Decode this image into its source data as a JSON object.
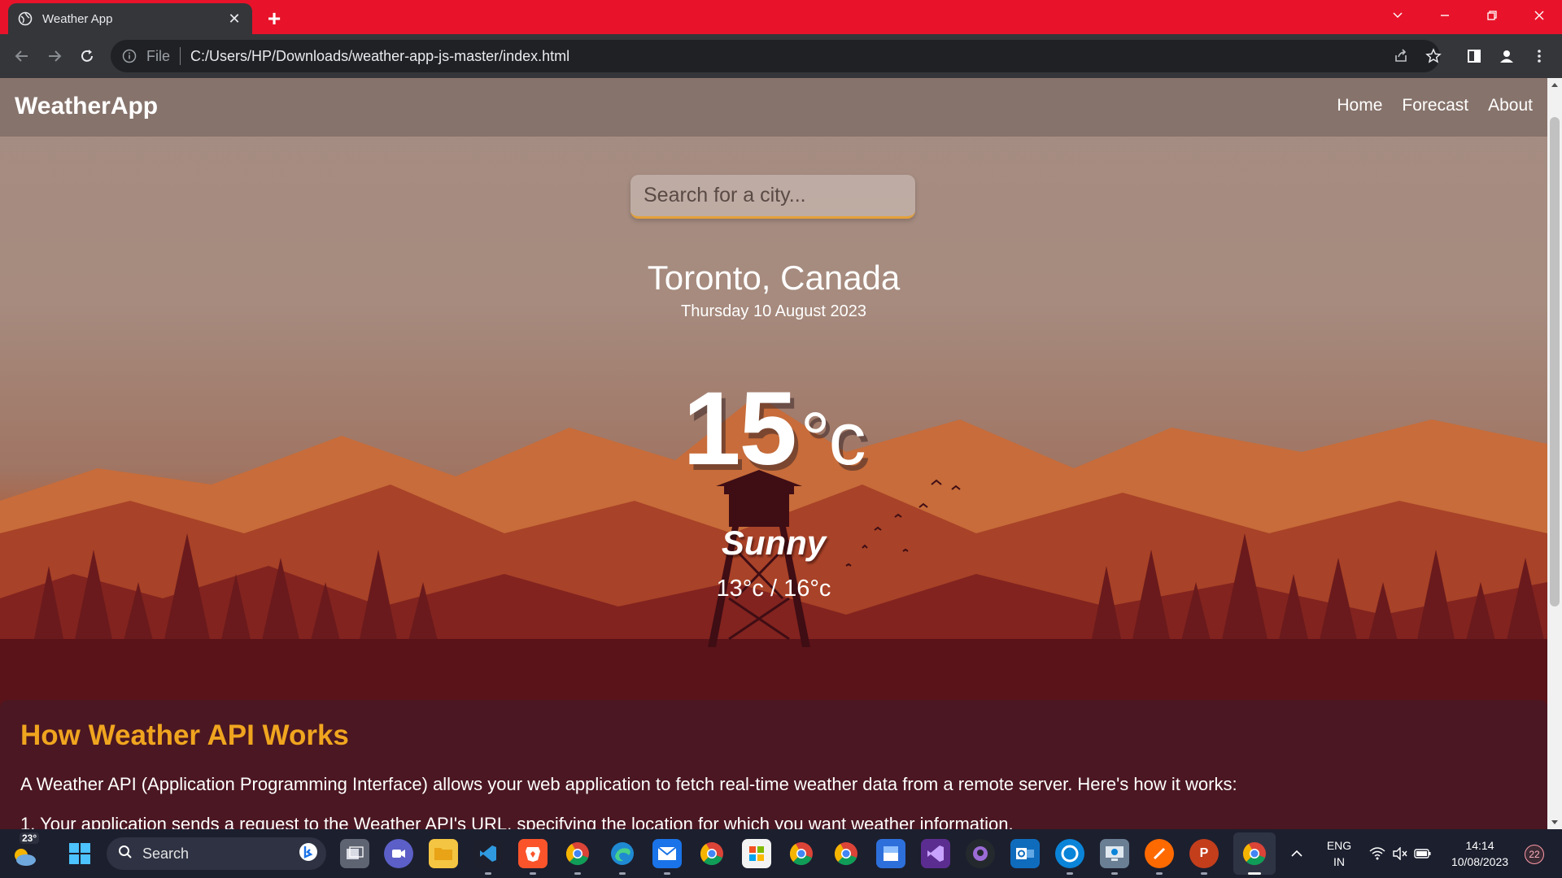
{
  "browser": {
    "tab_title": "Weather App",
    "tab_close": "✕",
    "new_tab": "+",
    "scheme_label": "File",
    "url": "C:/Users/HP/Downloads/weather-app-js-master/index.html"
  },
  "navbar": {
    "brand": "WeatherApp",
    "links": [
      "Home",
      "Forecast",
      "About"
    ]
  },
  "search": {
    "placeholder": "Search for a city..."
  },
  "weather": {
    "location": "Toronto, Canada",
    "date": "Thursday 10 August 2023",
    "temperature": "15",
    "unit": "°c",
    "condition": "Sunny",
    "hi_low": "13°c / 16°c"
  },
  "info": {
    "heading": "How Weather API Works",
    "text": "A Weather API (Application Programming Interface) allows your web application to fetch real-time weather data from a remote server. Here's how it works:",
    "step1": "1. Your application sends a request to the Weather API's URL, specifying the location for which you want weather information."
  },
  "taskbar": {
    "weather_badge": "23°",
    "search_label": "Search",
    "language": "ENG",
    "region": "IN",
    "time": "14:14",
    "date": "10/08/2023",
    "notifications": "22"
  },
  "colors": {
    "tab_strip": "#e8132a",
    "accent_heading": "#f0a51f",
    "search_underline": "#e3a13a"
  }
}
